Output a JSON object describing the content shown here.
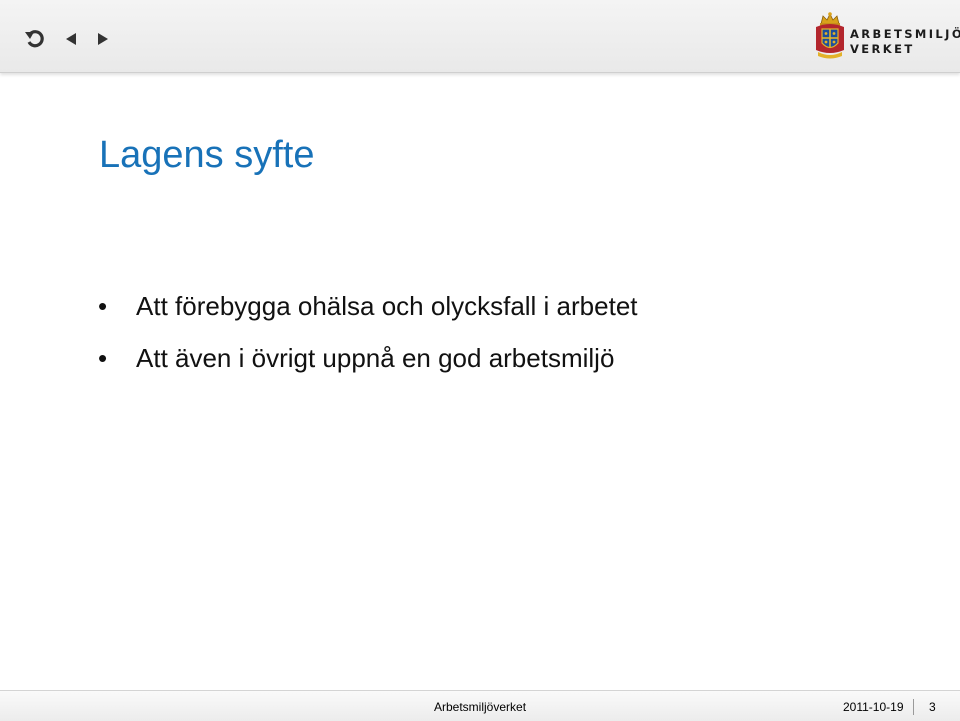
{
  "nav": {
    "icons": [
      "return-icon",
      "previous-arrow-icon",
      "next-arrow-icon"
    ]
  },
  "logo": {
    "line1": "ARBETSMILJÖ",
    "line2": "VERKET"
  },
  "slide": {
    "title": "Lagens syfte",
    "bullet_symbol": "•",
    "bullets": [
      "Att förebygga ohälsa och olycksfall i arbetet",
      "Att även i övrigt uppnå en god arbetsmiljö"
    ]
  },
  "footer": {
    "organization": "Arbetsmiljöverket",
    "date": "2011-10-19",
    "page_number": "3"
  },
  "colors": {
    "title": "#1872b8",
    "text": "#111111",
    "nav_icon": "#333333"
  }
}
